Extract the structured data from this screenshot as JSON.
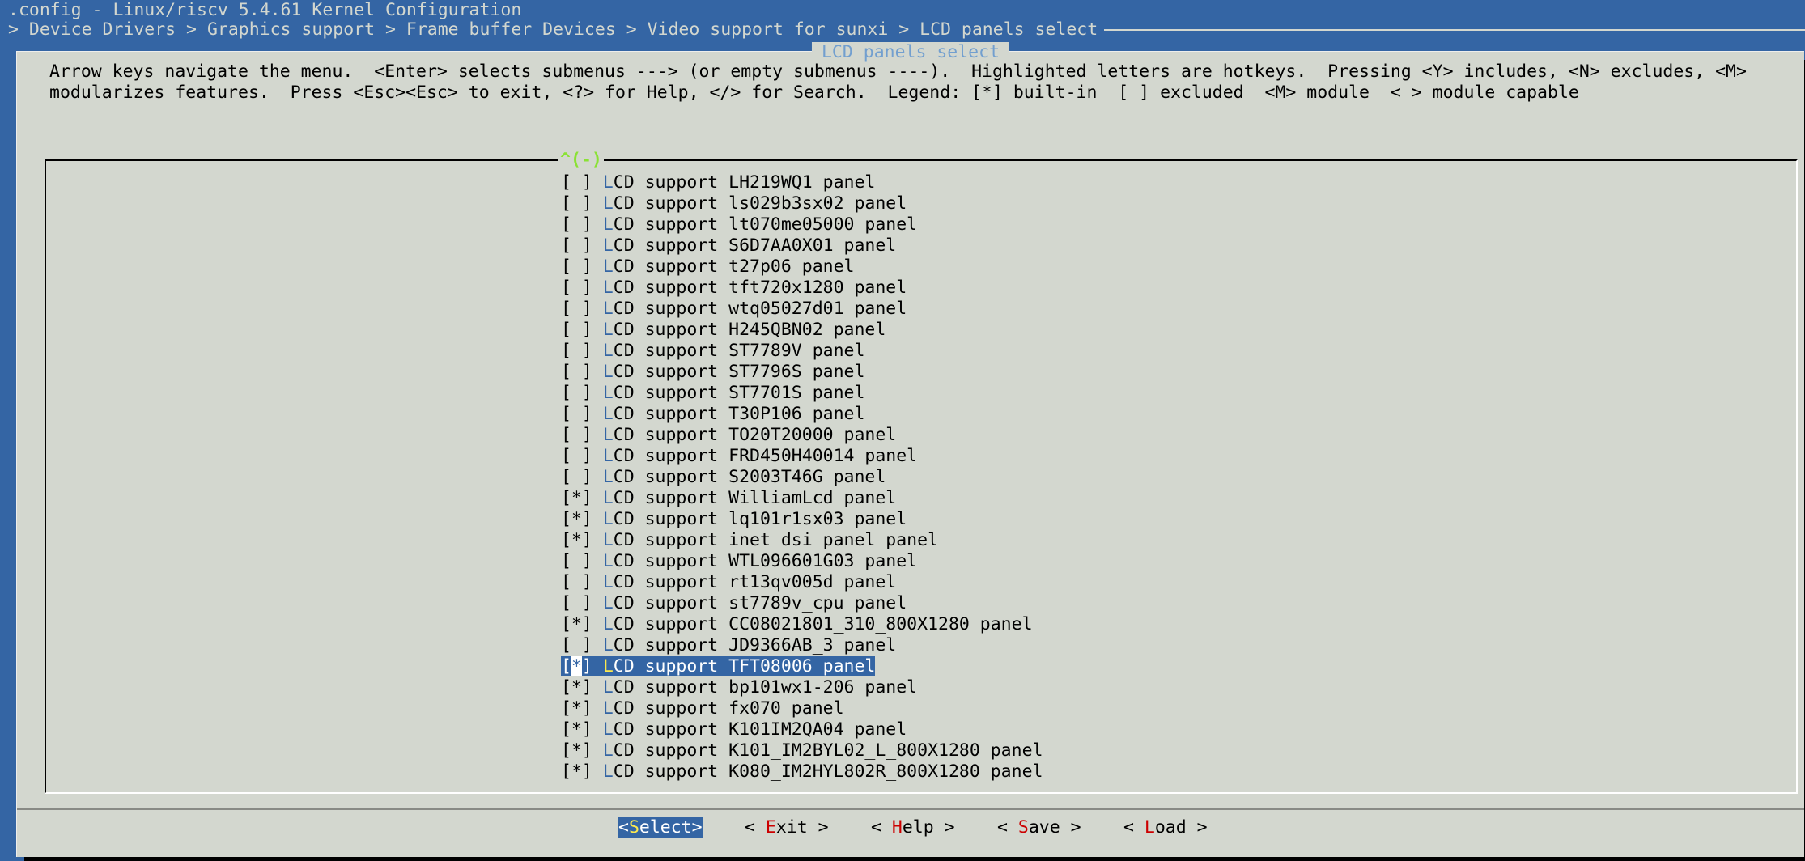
{
  "header": {
    "title": ".config - Linux/riscv 5.4.61 Kernel Configuration",
    "breadcrumb": "> Device Drivers > Graphics support > Frame buffer Devices > Video support for sunxi > LCD panels select"
  },
  "dialog": {
    "title": "LCD panels select",
    "help_line1": "Arrow keys navigate the menu.  <Enter> selects submenus ---> (or empty submenus ----).  Highlighted letters are hotkeys.  Pressing <Y> includes, <N> excludes, <M>",
    "help_line2": "modularizes features.  Press <Esc><Esc> to exit, <?> for Help, </> for Search.  Legend: [*] built-in  [ ] excluded  <M> module  < > module capable",
    "scroll_indicator": "^(-)"
  },
  "menu": {
    "items": [
      {
        "state": "[ ]",
        "hotkey": "L",
        "rest": "CD support LH219WQ1 panel"
      },
      {
        "state": "[ ]",
        "hotkey": "L",
        "rest": "CD support ls029b3sx02 panel"
      },
      {
        "state": "[ ]",
        "hotkey": "L",
        "rest": "CD support lt070me05000 panel"
      },
      {
        "state": "[ ]",
        "hotkey": "L",
        "rest": "CD support S6D7AA0X01 panel"
      },
      {
        "state": "[ ]",
        "hotkey": "L",
        "rest": "CD support t27p06 panel"
      },
      {
        "state": "[ ]",
        "hotkey": "L",
        "rest": "CD support tft720x1280 panel"
      },
      {
        "state": "[ ]",
        "hotkey": "L",
        "rest": "CD support wtq05027d01 panel"
      },
      {
        "state": "[ ]",
        "hotkey": "L",
        "rest": "CD support H245QBN02 panel"
      },
      {
        "state": "[ ]",
        "hotkey": "L",
        "rest": "CD support ST7789V panel"
      },
      {
        "state": "[ ]",
        "hotkey": "L",
        "rest": "CD support ST7796S panel"
      },
      {
        "state": "[ ]",
        "hotkey": "L",
        "rest": "CD support ST7701S panel"
      },
      {
        "state": "[ ]",
        "hotkey": "L",
        "rest": "CD support T30P106 panel"
      },
      {
        "state": "[ ]",
        "hotkey": "L",
        "rest": "CD support TO20T20000 panel"
      },
      {
        "state": "[ ]",
        "hotkey": "L",
        "rest": "CD support FRD450H40014 panel"
      },
      {
        "state": "[ ]",
        "hotkey": "L",
        "rest": "CD support S2003T46G panel"
      },
      {
        "state": "[*]",
        "hotkey": "L",
        "rest": "CD support WilliamLcd panel"
      },
      {
        "state": "[*]",
        "hotkey": "L",
        "rest": "CD support lq101r1sx03 panel"
      },
      {
        "state": "[*]",
        "hotkey": "L",
        "rest": "CD support inet_dsi_panel panel"
      },
      {
        "state": "[ ]",
        "hotkey": "L",
        "rest": "CD support WTL096601G03 panel"
      },
      {
        "state": "[ ]",
        "hotkey": "L",
        "rest": "CD support rt13qv005d panel"
      },
      {
        "state": "[ ]",
        "hotkey": "L",
        "rest": "CD support st7789v_cpu panel"
      },
      {
        "state": "[*]",
        "hotkey": "L",
        "rest": "CD support CC08021801_310_800X1280 panel"
      },
      {
        "state": "[ ]",
        "hotkey": "L",
        "rest": "CD support JD9366AB_3 panel"
      },
      {
        "state": "[*]",
        "hotkey": "L",
        "rest": "CD support TFT08006 panel",
        "selected": true
      },
      {
        "state": "[*]",
        "hotkey": "L",
        "rest": "CD support bp101wx1-206 panel"
      },
      {
        "state": "[*]",
        "hotkey": "L",
        "rest": "CD support fx070 panel"
      },
      {
        "state": "[*]",
        "hotkey": "L",
        "rest": "CD support K101IM2QA04 panel"
      },
      {
        "state": "[*]",
        "hotkey": "L",
        "rest": "CD support K101_IM2BYL02_L_800X1280 panel"
      },
      {
        "state": "[*]",
        "hotkey": "L",
        "rest": "CD support K080_IM2HYL802R_800X1280 panel"
      }
    ]
  },
  "buttons": {
    "select": {
      "pre": "<",
      "hotkey": "S",
      "post": "elect>"
    },
    "exit": {
      "pre": "< ",
      "hotkey": "E",
      "post": "xit >"
    },
    "help": {
      "pre": "< ",
      "hotkey": "H",
      "post": "elp >"
    },
    "save": {
      "pre": "< ",
      "hotkey": "S",
      "post": "ave >"
    },
    "load": {
      "pre": "< ",
      "hotkey": "L",
      "post": "oad >"
    }
  },
  "colors": {
    "background": "#3465a4",
    "dialog": "#d3d7cf",
    "hotkey_item": "#3465a4",
    "hotkey_button": "#cc0000",
    "selected_hotkey": "#fce94f",
    "scroll_indicator": "#8ae234"
  }
}
